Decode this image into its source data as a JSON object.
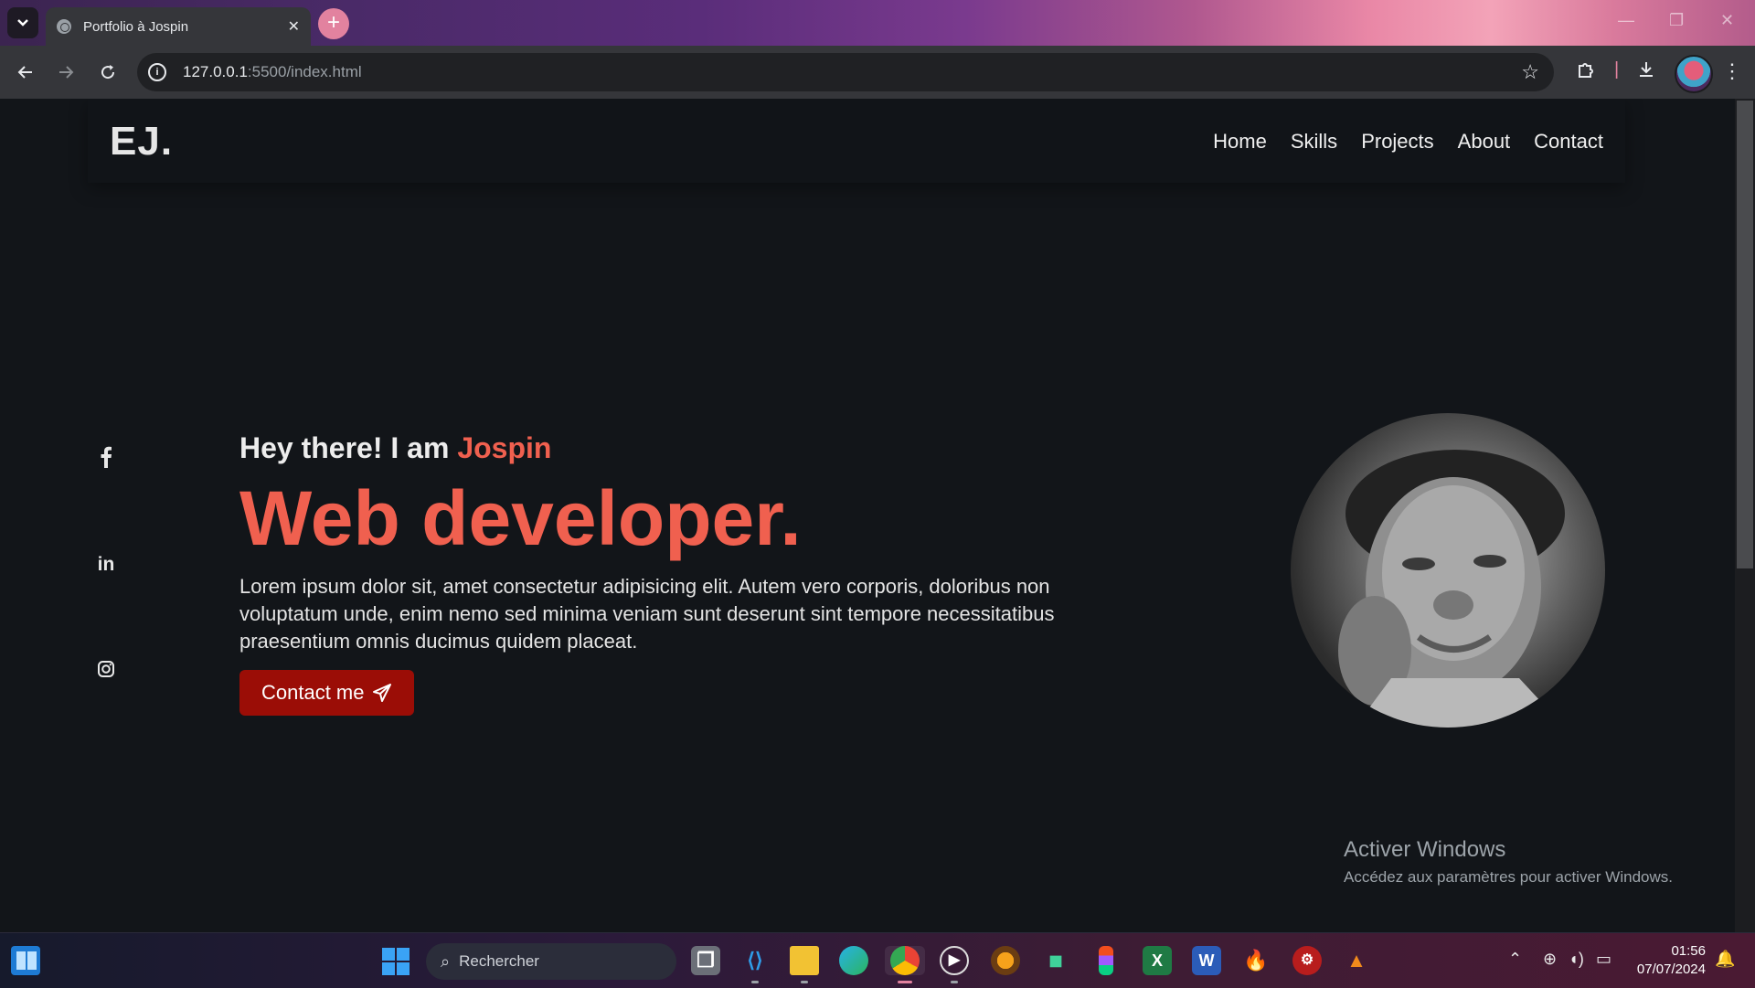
{
  "browser": {
    "tab_title": "Portfolio à Jospin",
    "tab_close": "✕",
    "new_tab": "+",
    "url_host": "127.0.0.1",
    "url_rest": ":5500/index.html"
  },
  "site": {
    "logo": "EJ.",
    "nav": [
      "Home",
      "Skills",
      "Projects",
      "About",
      "Contact"
    ],
    "greeting_prefix": "Hey there! I am",
    "greeting_name": "Jospin",
    "role": "Web developer.",
    "bio": "Lorem ipsum dolor sit, amet consectetur adipisicing elit. Autem vero corporis, doloribus non voluptatum unde, enim nemo sed minima veniam sunt deserunt sint tempore necessitatibus praesentium omnis ducimus quidem placeat.",
    "contact_button": "Contact me",
    "socials": [
      "facebook-icon",
      "linkedin-icon",
      "instagram-icon"
    ]
  },
  "watermark": {
    "title": "Activer Windows",
    "subtitle": "Accédez aux paramètres pour activer Windows."
  },
  "taskbar": {
    "search_placeholder": "Rechercher",
    "time": "01:56",
    "date": "07/07/2024",
    "apps": [
      "task-view",
      "vscode",
      "file-explorer",
      "edge",
      "chrome",
      "media-player",
      "fl-studio",
      "git",
      "figma",
      "excel",
      "word",
      "firebase",
      "app-red",
      "vlc"
    ]
  },
  "colors": {
    "accent": "#f0604f",
    "button": "#9b0d06",
    "page_bg": "#121519"
  }
}
